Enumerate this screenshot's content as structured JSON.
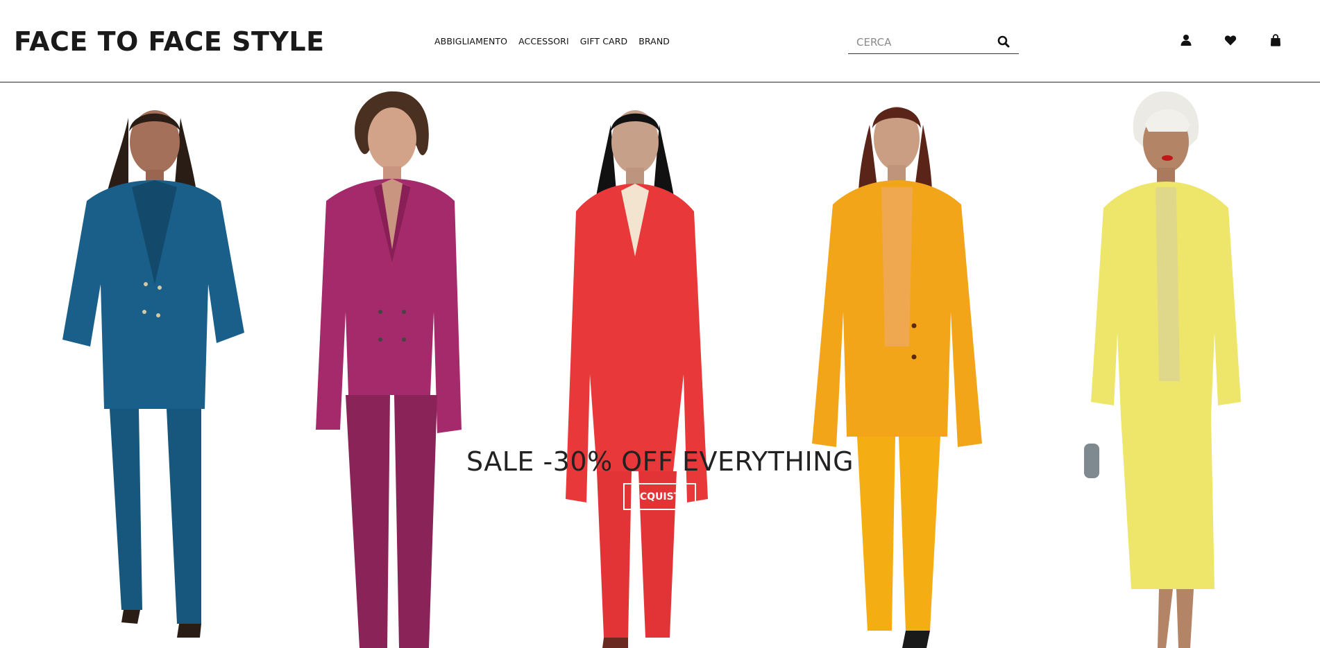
{
  "header": {
    "logo": "FACE TO FACE STYLE",
    "nav": [
      "ABBIGLIAMENTO",
      "ACCESSORI",
      "GIFT CARD",
      "BRAND"
    ],
    "search": {
      "placeholder": "CERCA",
      "value": ""
    },
    "icons": [
      "user-icon",
      "heart-icon",
      "shopping-bag-icon"
    ]
  },
  "hero": {
    "headline": "SALE -30% OFF EVERYTHING",
    "cta": "ACQUISTA",
    "models": [
      {
        "name": "model-blue-suit",
        "color": "#1a5f8a"
      },
      {
        "name": "model-magenta-suit",
        "color": "#a42a6c"
      },
      {
        "name": "model-red-suit",
        "color": "#e8383a"
      },
      {
        "name": "model-orange-suit",
        "color": "#f3a51a"
      },
      {
        "name": "model-yellow-suit",
        "color": "#eee66a"
      }
    ]
  }
}
